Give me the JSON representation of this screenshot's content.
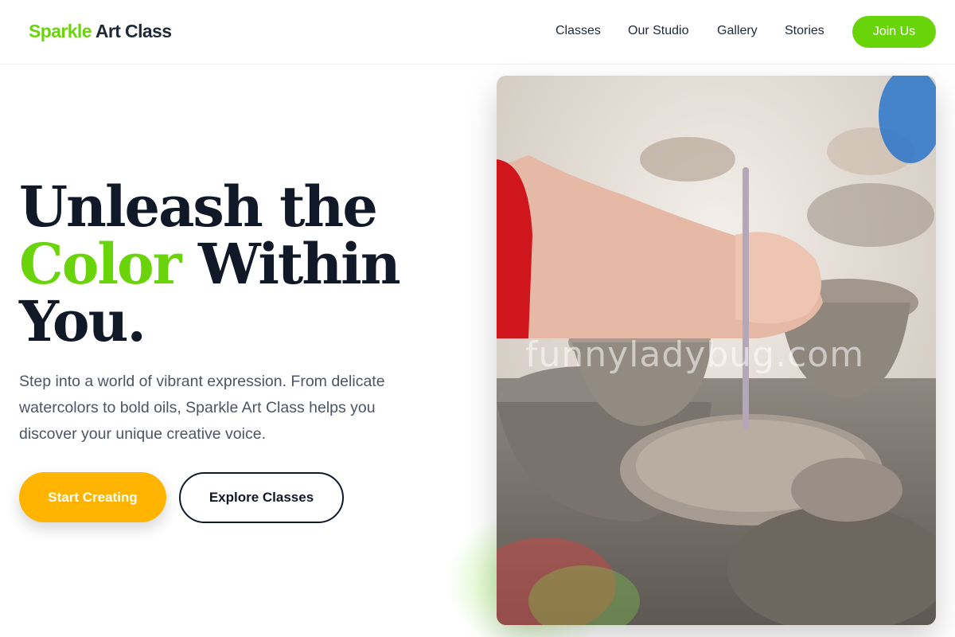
{
  "header": {
    "logo_brand": "Sparkle",
    "logo_rest": "Art Class",
    "nav": [
      "Classes",
      "Our Studio",
      "Gallery",
      "Stories"
    ],
    "cta": "Join Us"
  },
  "hero": {
    "title_line1": "Unleash the",
    "title_accent": "Color",
    "title_line2_rest": "Within",
    "title_line3": "You.",
    "description": "Step into a world of vibrant expression. From delicate watercolors to bold oils, Sparkle Art Class helps you discover your unique creative voice.",
    "primary_button": "Start Creating",
    "secondary_button": "Explore Classes",
    "image_watermark": "funnyladybug.com"
  },
  "colors": {
    "accent": "#6ad40b",
    "primary_button": "#ffb400",
    "text_dark": "#111827",
    "text_body": "#4b5563"
  }
}
